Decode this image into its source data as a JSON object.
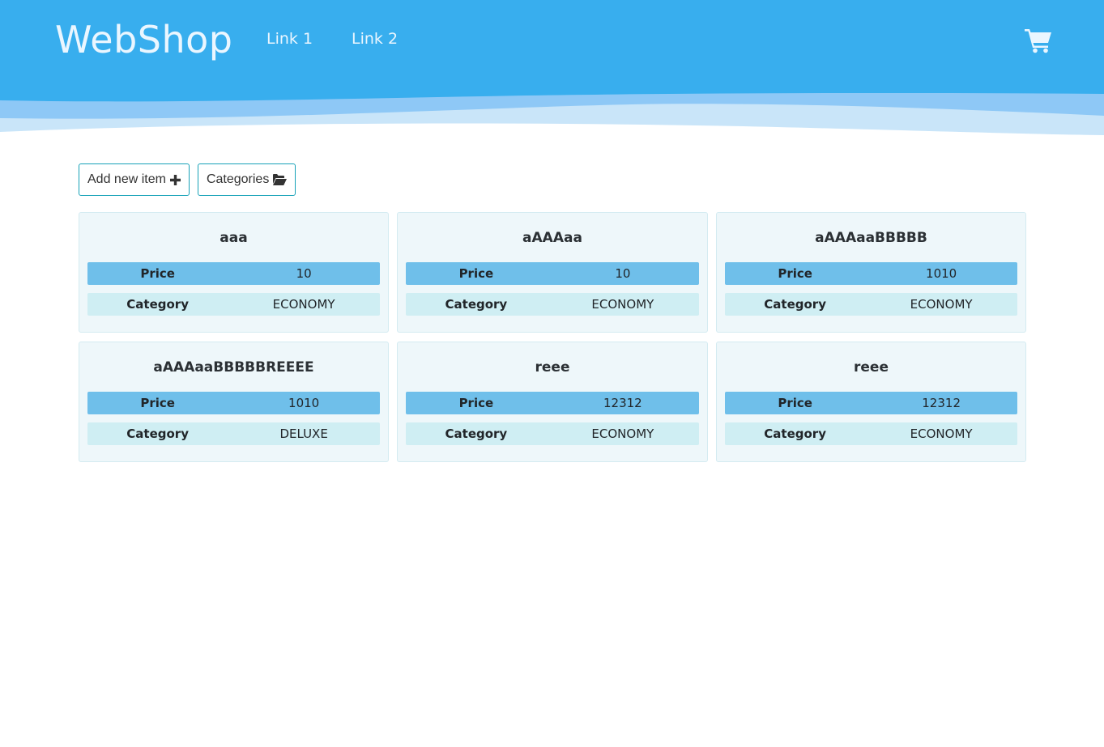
{
  "header": {
    "brand": "WebShop",
    "links": [
      "Link 1",
      "Link 2"
    ],
    "cart_icon": "shopping-cart-icon",
    "colors": {
      "primary": "#38aeee",
      "wave_mid": "#8ec8f6",
      "wave_light": "#c9e5f9"
    }
  },
  "toolbar": {
    "add_label": "Add new item",
    "add_icon": "plus-icon",
    "categories_label": "Categories",
    "categories_icon": "folder-open-icon",
    "border_color": "#17a2b8"
  },
  "labels": {
    "price": "Price",
    "category": "Category"
  },
  "items": [
    {
      "name": "aaa",
      "price": "10",
      "category": "ECONOMY"
    },
    {
      "name": "aAAAaa",
      "price": "10",
      "category": "ECONOMY"
    },
    {
      "name": "aAAAaaBBBBB",
      "price": "1010",
      "category": "ECONOMY"
    },
    {
      "name": "aAAAaaBBBBBREEEE",
      "price": "1010",
      "category": "DELUXE"
    },
    {
      "name": "reee",
      "price": "12312",
      "category": "ECONOMY"
    },
    {
      "name": "reee",
      "price": "12312",
      "category": "ECONOMY"
    }
  ]
}
